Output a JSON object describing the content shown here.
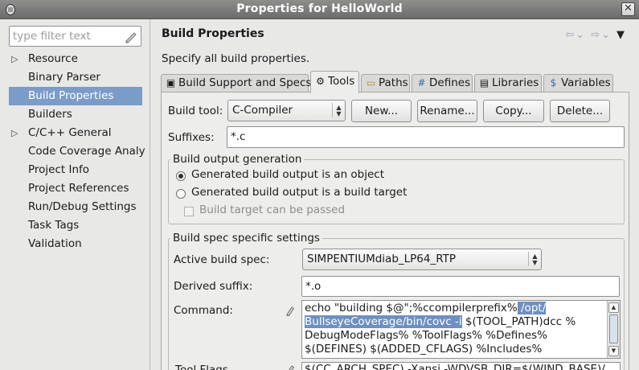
{
  "window": {
    "title": "Properties for HelloWorld",
    "app_icon": "eclipse-icon",
    "close_icon": "close-icon",
    "close_glyph": "✕"
  },
  "filter": {
    "placeholder": "type filter text",
    "value": ""
  },
  "nav": {
    "items": [
      {
        "label": "Resource",
        "expandable": true
      },
      {
        "label": "Binary Parser"
      },
      {
        "label": "Build Properties",
        "selected": true
      },
      {
        "label": "Builders"
      },
      {
        "label": "C/C++ General",
        "expandable": true
      },
      {
        "label": "Code Coverage Analy"
      },
      {
        "label": "Project Info"
      },
      {
        "label": "Project References"
      },
      {
        "label": "Run/Debug Settings"
      },
      {
        "label": "Task Tags"
      },
      {
        "label": "Validation"
      }
    ]
  },
  "header": {
    "title": "Build Properties",
    "description": "Specify all build properties."
  },
  "tabs": [
    {
      "label": "Build Support and Specs",
      "icon": "build-support-icon"
    },
    {
      "label": "Tools",
      "icon": "tools-icon",
      "active": true
    },
    {
      "label": "Paths",
      "icon": "folder-icon"
    },
    {
      "label": "Defines",
      "icon": "hash-icon"
    },
    {
      "label": "Libraries",
      "icon": "library-icon"
    },
    {
      "label": "Variables",
      "icon": "dollar-icon"
    }
  ],
  "tools": {
    "build_tool_label": "Build tool:",
    "build_tool_value": "C-Compiler",
    "new_button": "New...",
    "rename_button": "Rename...",
    "copy_button": "Copy...",
    "delete_button": "Delete...",
    "suffixes_label": "Suffixes:",
    "suffixes_value": "*.c"
  },
  "output_group": {
    "title": "Build output generation",
    "option_object": "Generated build output is an object",
    "option_target": "Generated build output is a build target",
    "selected": "object",
    "target_passed": "Build target can be passed",
    "target_passed_enabled": false
  },
  "spec_group": {
    "title": "Build spec specific settings",
    "active_spec_label": "Active build spec:",
    "active_spec_value": "SIMPENTIUMdiab_LP64_RTP",
    "derived_suffix_label": "Derived suffix:",
    "derived_suffix_value": "*.o",
    "command_label": "Command:",
    "command_lines": {
      "l1_plain": "echo \"building $@\";%ccompilerprefix%",
      "l1_sel": " /opt/",
      "l2_sel": "BullseyeCoverage/bin/covc -i",
      "l2_plain": " $(TOOL_PATH)dcc %",
      "l3": "DebugModeFlags% %ToolFlags% %Defines%",
      "l4": "$(DEFINES) $(ADDED_CFLAGS) %Includes%"
    },
    "tool_flags_label": "Tool Flags",
    "tool_flags_value": "$(CC_ARCH_SPEC) -Xansi -WDVSB_DIR=$(WIND_BASE)/"
  }
}
